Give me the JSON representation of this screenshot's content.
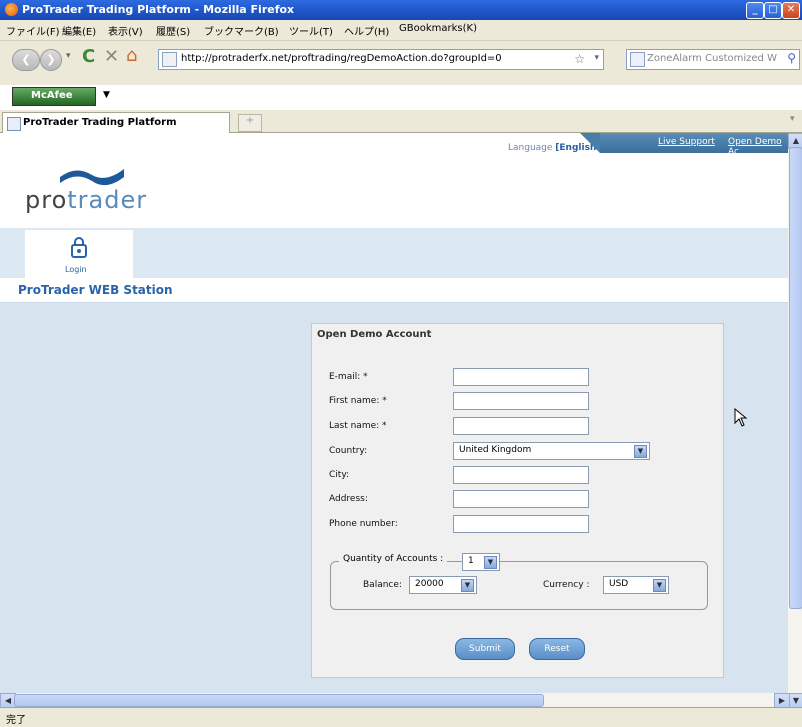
{
  "window": {
    "title": "ProTrader Trading Platform - Mozilla Firefox"
  },
  "menu": [
    "ファイル(F)",
    "編集(E)",
    "表示(V)",
    "履歴(S)",
    "ブックマーク(B)",
    "ツール(T)",
    "ヘルプ(H)",
    "GBookmarks(K)"
  ],
  "navbar": {
    "url": "http://protraderfx.net/proftrading/regDemoAction.do?groupId=0",
    "search_placeholder": "ZoneAlarm Customized W"
  },
  "mcafee": {
    "label": "McAfee"
  },
  "tab": {
    "title": "ProTrader Trading Platform",
    "new_tab": "+"
  },
  "header": {
    "language_label": "Language",
    "language_value": "[English ▾]",
    "live_support": "Live Support",
    "open_demo": "Open Demo Ac",
    "logo_pro": "pro",
    "logo_trader": "trader"
  },
  "nav": {
    "login_label": "Login"
  },
  "station": {
    "title": "ProTrader WEB Station"
  },
  "form": {
    "title": "Open Demo Account",
    "fields": {
      "email": {
        "label": "E-mail: *",
        "value": ""
      },
      "first_name": {
        "label": "First name: *",
        "value": ""
      },
      "last_name": {
        "label": "Last name: *",
        "value": ""
      },
      "country": {
        "label": "Country:",
        "value": "United Kingdom"
      },
      "city": {
        "label": "City:",
        "value": ""
      },
      "address": {
        "label": "Address:",
        "value": ""
      },
      "phone": {
        "label": "Phone number:",
        "value": ""
      }
    },
    "accounts": {
      "legend": "Quantity of Accounts :",
      "quantity": "1",
      "balance_label": "Balance:",
      "balance": "20000",
      "currency_label": "Currency :",
      "currency": "USD"
    },
    "submit": "Submit",
    "reset": "Reset"
  },
  "status": {
    "text": "完了"
  },
  "colors": {
    "accent": "#2a64a8",
    "page_bg": "#d7e4f0",
    "button": "#5a8ec8"
  }
}
